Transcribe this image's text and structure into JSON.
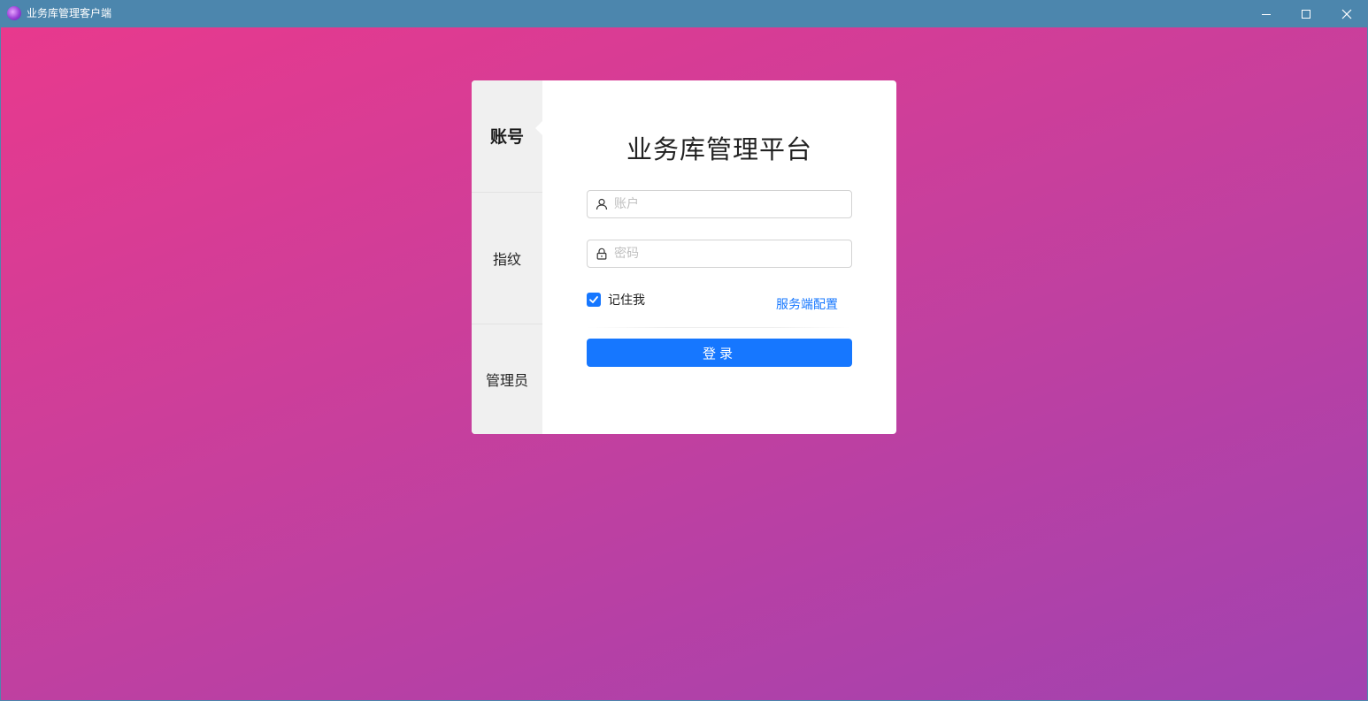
{
  "window": {
    "title": "业务库管理客户端",
    "icon": "app-logo-icon"
  },
  "colors": {
    "titlebar": "#4c86ad",
    "gradient_start": "#e8398d",
    "gradient_end": "#a142b0",
    "accent": "#1677ff"
  },
  "sidebar": {
    "tabs": [
      {
        "label": "账号",
        "active": true
      },
      {
        "label": "指纹",
        "active": false
      },
      {
        "label": "管理员",
        "active": false
      }
    ]
  },
  "form": {
    "heading": "业务库管理平台",
    "account": {
      "placeholder": "账户",
      "value": "",
      "icon": "user-icon"
    },
    "password": {
      "placeholder": "密码",
      "value": "",
      "icon": "lock-icon"
    },
    "remember_label": "记住我",
    "remember_checked": true,
    "server_config_label": "服务端配置",
    "login_label": "登录"
  }
}
